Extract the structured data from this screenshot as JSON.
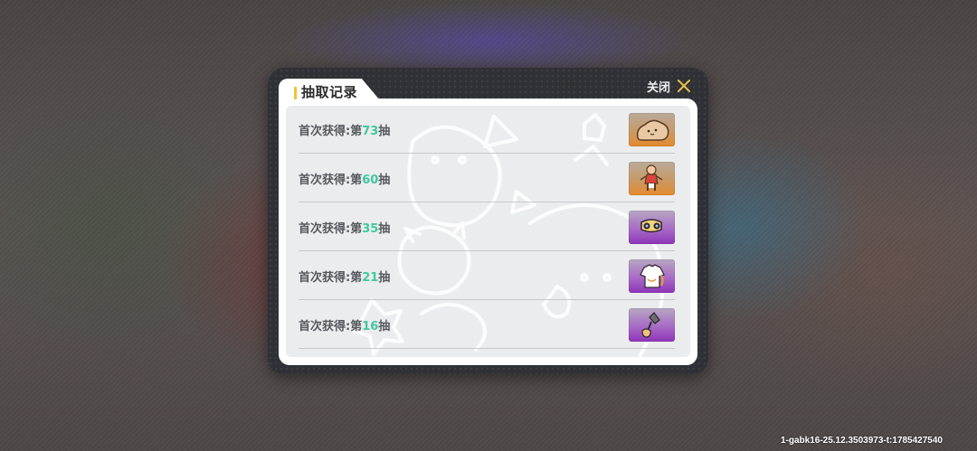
{
  "dialog": {
    "title": "抽取记录",
    "close_label": "关闭"
  },
  "records": [
    {
      "prefix": "首次获得:第",
      "number": "73",
      "suffix": "抽",
      "rarity": "orange",
      "item_icon": "plush-blob-icon"
    },
    {
      "prefix": "首次获得:第",
      "number": "60",
      "suffix": "抽",
      "rarity": "orange",
      "item_icon": "doll-figure-icon"
    },
    {
      "prefix": "首次获得:第",
      "number": "35",
      "suffix": "抽",
      "rarity": "purple",
      "item_icon": "goggles-icon"
    },
    {
      "prefix": "首次获得:第",
      "number": "21",
      "suffix": "抽",
      "rarity": "purple",
      "item_icon": "shirt-icon"
    },
    {
      "prefix": "首次获得:第",
      "number": "16",
      "suffix": "抽",
      "rarity": "purple",
      "item_icon": "lamp-icon"
    }
  ],
  "colors": {
    "accent_yellow": "#f2c230",
    "number_green": "#3ec9a0",
    "rarity_orange": "#e58a2c",
    "rarity_purple": "#8d35b9"
  },
  "watermark": "1-gabk16-25.12.3503973-t:1785427540"
}
